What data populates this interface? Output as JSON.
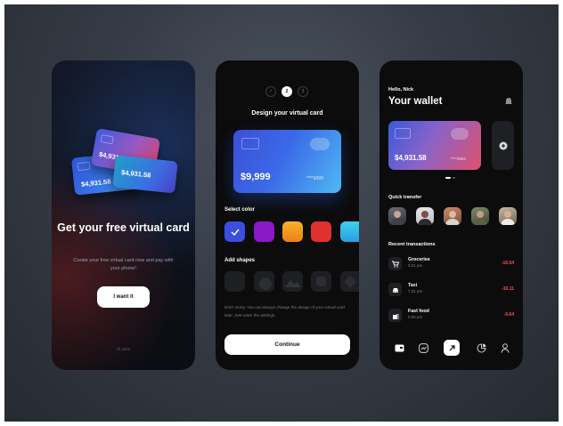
{
  "colors": {
    "accent_red": "#ff4f5a",
    "blue_card": "#3b69e8",
    "bg": "#363c46"
  },
  "onboarding": {
    "cards": [
      {
        "amount": "$4,931.58"
      },
      {
        "amount": "$4,931.58"
      },
      {
        "amount": "$4,931.58"
      }
    ],
    "title": "Get your free virtual card",
    "subtitle": "Create your free virtual card now and pay with your phone!",
    "cta_label": "I want it",
    "skip_label": "I'll pass"
  },
  "design": {
    "steps": [
      {
        "label": "✓"
      },
      {
        "label": "2"
      },
      {
        "label": "3"
      }
    ],
    "title": "Design your virtual card",
    "card_amount": "$9,999",
    "card_number": "****9999",
    "select_color_label": "Select color",
    "colors": [
      "#3a4fe0",
      "#8a18c9",
      "#f39a1b",
      "#e0312f",
      "#27b8e8"
    ],
    "add_shapes_label": "Add shapes",
    "note": "Don't worry. You can always change the design of your virtual card later. Just enter the settings.",
    "continue_label": "Continue"
  },
  "wallet": {
    "greeting": "Hello, Nick",
    "title": "Your wallet",
    "card_amount": "$4,931.58",
    "card_number": "****3353",
    "quick_transfer_label": "Quick transfer",
    "recent_label": "Recent transactions",
    "transactions": [
      {
        "name": "Groceries",
        "time": "5:01 pm",
        "amount": "-16.54",
        "icon": "cart-icon"
      },
      {
        "name": "Taxi",
        "time": "7:31 pm",
        "amount": "-10.11",
        "icon": "car-icon"
      },
      {
        "name": "Fast food",
        "time": "5:05 pm",
        "amount": "-9.64",
        "icon": "food-icon"
      }
    ],
    "nav_icons": [
      "card-icon",
      "chart-icon",
      "transfer-icon",
      "pie-icon",
      "profile-icon"
    ]
  }
}
